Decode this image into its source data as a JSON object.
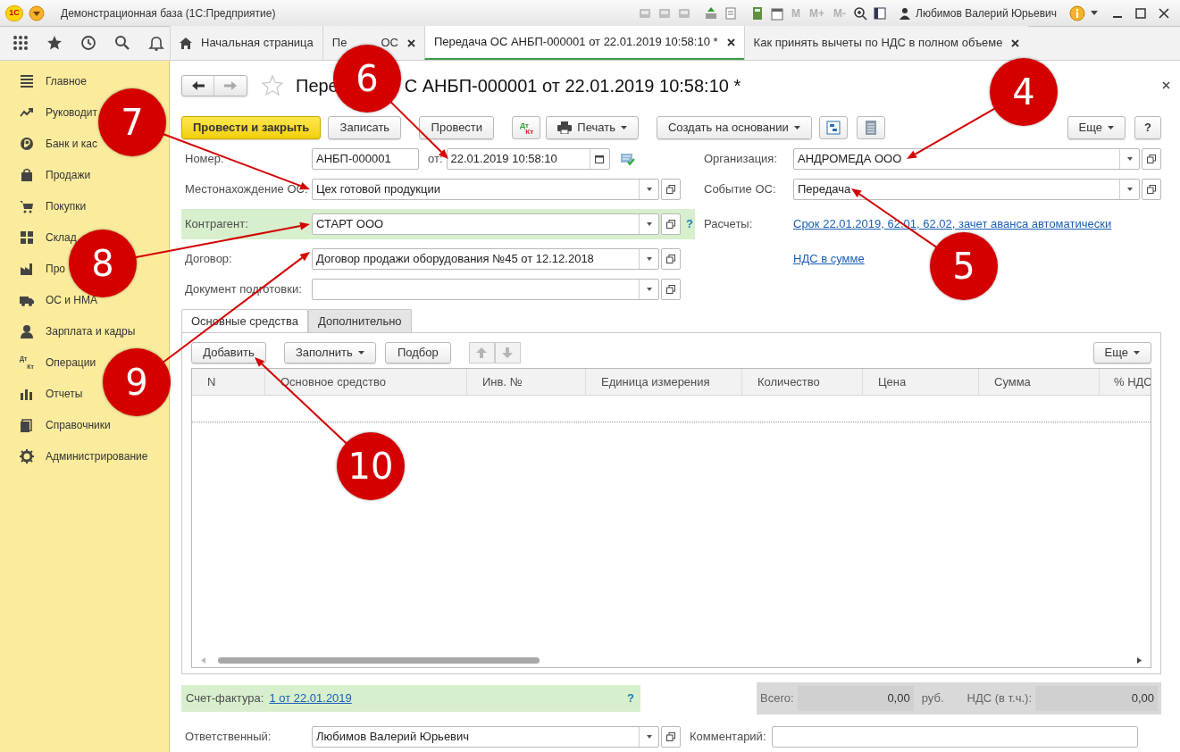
{
  "app": {
    "logo": "1С",
    "title": "Демонстрационная база (1С:Предприятие)",
    "memory_keys": [
      "M",
      "M+",
      "M-"
    ],
    "user": "Любимов Валерий Юрьевич"
  },
  "tabs": [
    {
      "kind": "home",
      "label": "Начальная страница",
      "selected": false
    },
    {
      "kind": "doc",
      "label": "Пе",
      "label_end": "ОС",
      "selected": false
    },
    {
      "kind": "doc",
      "label": "Передача ОС АНБП-000001 от 22.01.2019 10:58:10 *",
      "selected": true
    },
    {
      "kind": "doc",
      "label": "Как принять вычеты по НДС в полном объеме",
      "selected": false
    }
  ],
  "sidebar": {
    "items": [
      {
        "label": "Главное"
      },
      {
        "label": "Руководит"
      },
      {
        "label": "Банк и кас"
      },
      {
        "label": "Продажи"
      },
      {
        "label": "Покупки"
      },
      {
        "label": "Склад"
      },
      {
        "label": "Про"
      },
      {
        "label": "ОС и НМА"
      },
      {
        "label": "Зарплата и кадры"
      },
      {
        "label": "Операции",
        "icon_text": [
          "Дт",
          "Кт"
        ]
      },
      {
        "label": "Отчеты"
      },
      {
        "label": "Справочники"
      },
      {
        "label": "Администрирование"
      }
    ]
  },
  "document": {
    "title_start": "Пере",
    "title_end": "С АНБП-000001 от 22.01.2019 10:58:10 *",
    "toolbar": [
      {
        "kind": "primary",
        "label": "Провести и закрыть"
      },
      {
        "kind": "button",
        "label": "Записать"
      },
      {
        "kind": "button",
        "label": "Провести"
      },
      {
        "kind": "dtkt",
        "icon_text": [
          "Дт",
          "Кт"
        ]
      },
      {
        "kind": "menu",
        "label": "Печать"
      },
      {
        "kind": "menu",
        "label": "Создать на основании"
      },
      {
        "kind": "structure"
      },
      {
        "kind": "ledger"
      }
    ],
    "toolbar_right": [
      {
        "kind": "menu",
        "label": "Еще"
      },
      {
        "kind": "button",
        "label": "?"
      }
    ],
    "number": {
      "label": "Номер:",
      "value": "АНБП-000001",
      "date_label": "от:",
      "date": "22.01.2019 10:58:10"
    },
    "left_fields": [
      {
        "label": "Местонахождение ОС:",
        "value": "Цех готовой продукции",
        "highlighted": false
      },
      {
        "label": "Контрагент:",
        "value": "СТАРТ ООО",
        "highlighted": true,
        "help_text": "?"
      },
      {
        "label": "Договор:",
        "value": "Договор продажи оборудования №45 от 12.12.2018",
        "highlighted": false
      },
      {
        "label": "Документ подготовки:",
        "highlighted": false
      }
    ],
    "right_fields": [
      {
        "kind": "select",
        "label": "Организация:",
        "value": "АНДРОМЕДА ООО"
      },
      {
        "kind": "select",
        "label": "Событие ОС:",
        "value": "Передача"
      },
      {
        "kind": "link",
        "label": "Расчеты:",
        "value": "Срок 22.01.2019, 62.01, 62.02, зачет аванса автоматически"
      },
      {
        "kind": "link",
        "value": "НДС в сумме"
      }
    ],
    "sections": [
      {
        "label": "Основные средства",
        "selected": true
      },
      {
        "label": "Дополнительно",
        "selected": false
      }
    ],
    "table_toolbar": [
      {
        "kind": "button",
        "label": "Добавить"
      },
      {
        "kind": "menu",
        "label": "Заполнить"
      },
      {
        "kind": "button",
        "label": "Подбор"
      },
      {
        "kind": "up"
      },
      {
        "kind": "down"
      }
    ],
    "table_toolbar_right": {
      "label": "Еще"
    },
    "table": {
      "columns": [
        "N",
        "Основное средство",
        "Инв. №",
        "Единица измерения",
        "Количество",
        "Цена",
        "Сумма",
        "% НДС"
      ]
    },
    "invoice": {
      "label": "Счет-фактура:",
      "link": "1 от 22.01.2019",
      "help": "?"
    },
    "totals": {
      "total_label": "Всего:",
      "total": "0,00",
      "currency": "руб.",
      "vat_label": "НДС (в т.ч.):",
      "vat": "0,00"
    },
    "responsible": {
      "label": "Ответственный:",
      "value": "Любимов Валерий Юрьевич"
    },
    "comment": {
      "label": "Комментарий:"
    }
  },
  "callouts": [
    {
      "number": "6"
    },
    {
      "number": "7"
    },
    {
      "number": "8"
    },
    {
      "number": "9"
    },
    {
      "number": "10"
    },
    {
      "number": "4"
    },
    {
      "number": "5"
    }
  ]
}
